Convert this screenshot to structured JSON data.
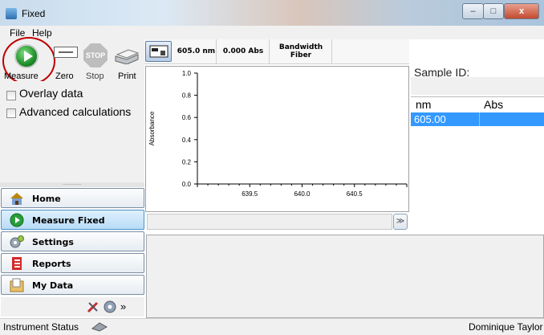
{
  "window": {
    "title": "Fixed",
    "minimize": "–",
    "maximize": "□",
    "close": "x"
  },
  "menu": [
    "File",
    "Help"
  ],
  "toolbar": {
    "measure": "Measure",
    "zero": "Zero",
    "stop": "Stop",
    "print": "Print",
    "stop_icon_text": "STOP"
  },
  "options": {
    "overlay": "Overlay data",
    "advanced": "Advanced calculations"
  },
  "grip": "..............",
  "nav": {
    "items": [
      {
        "label": "Home",
        "icon": "home-icon"
      },
      {
        "label": "Measure Fixed",
        "icon": "play-icon",
        "active": true
      },
      {
        "label": "Settings",
        "icon": "gears-icon"
      },
      {
        "label": "Reports",
        "icon": "report-icon"
      },
      {
        "label": "My Data",
        "icon": "folder-icon"
      }
    ],
    "more": "»"
  },
  "center": {
    "wavelength": "605.0 nm",
    "abs": "0.000 Abs",
    "bandwidth": "Bandwidth",
    "fiber": "Fiber",
    "expand": "≫"
  },
  "chart_data": {
    "type": "line",
    "ylabel": "Absorbance",
    "xlabel": "",
    "ylim": [
      0.0,
      1.0
    ],
    "yticks": [
      "1.0",
      "0.8",
      "0.6",
      "0.4",
      "0.2",
      "0.0"
    ],
    "xlim": [
      639.0,
      641.0
    ],
    "xticks": [
      "639.5",
      "640.0",
      "640.5"
    ],
    "series": []
  },
  "sample": {
    "label": "Sample ID:",
    "value": ""
  },
  "table": {
    "headers": [
      "nm",
      "Abs"
    ],
    "rows": [
      [
        "605.00",
        ""
      ]
    ]
  },
  "status": {
    "left": "Instrument Status",
    "right": "Dominique Taylor"
  }
}
